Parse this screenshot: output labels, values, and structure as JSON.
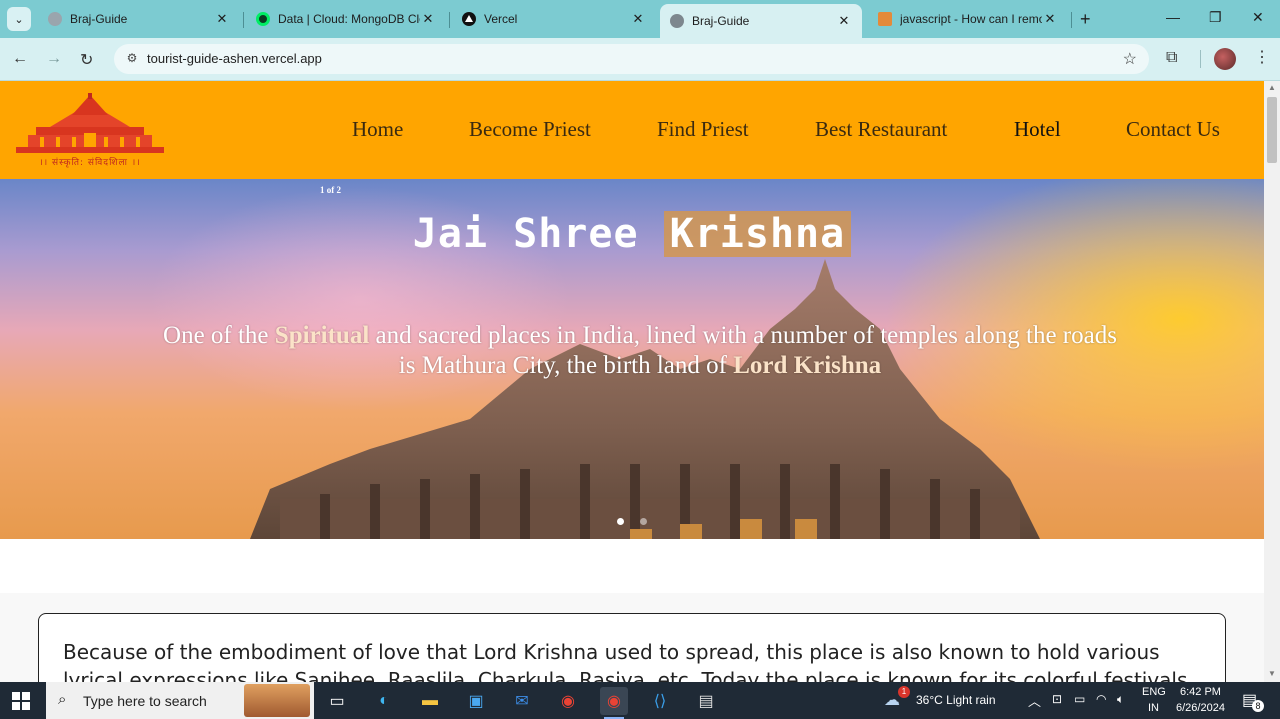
{
  "browser": {
    "tabs": [
      {
        "title": "Braj-Guide",
        "active": false
      },
      {
        "title": "Data | Cloud: MongoDB Cloud",
        "active": false
      },
      {
        "title": "Vercel",
        "active": false
      },
      {
        "title": "Braj-Guide",
        "active": true
      },
      {
        "title": "javascript - How can I remove",
        "active": false
      }
    ],
    "url": "tourist-guide-ashen.vercel.app"
  },
  "site": {
    "logo_text": "।। संस्कृति: संविदशिला ।।",
    "nav": [
      "Home",
      "Become Priest",
      "Find Priest",
      "Best Restaurant",
      "Hotel",
      "Contact Us"
    ],
    "hero": {
      "counter": "1 of 2",
      "title_start": "Jai Shree",
      "title_highlight": "Krishna",
      "sub_1": "One of the",
      "sub_accent_1": "Spiritual",
      "sub_2": "and sacred places in India, lined with a number of temples along the roads is Mathura City, the birth land of",
      "sub_accent_2": "Lord Krishna",
      "slide_index": 1,
      "slide_count": 2
    },
    "card_text": "Because of the embodiment of love that Lord Krishna used to spread, this place is also known to hold various lyrical expressions like Sanjhee, Raaslila, Charkula, Rasiya, etc. Today the place is known for its colorful festivals that are celebrated"
  },
  "taskbar": {
    "search_placeholder": "Type here to search",
    "weather": "36°C  Light rain",
    "lang_1": "ENG",
    "lang_2": "IN",
    "time": "6:42 PM",
    "date": "6/26/2024",
    "notif_count": "8",
    "weather_badge": "1"
  }
}
